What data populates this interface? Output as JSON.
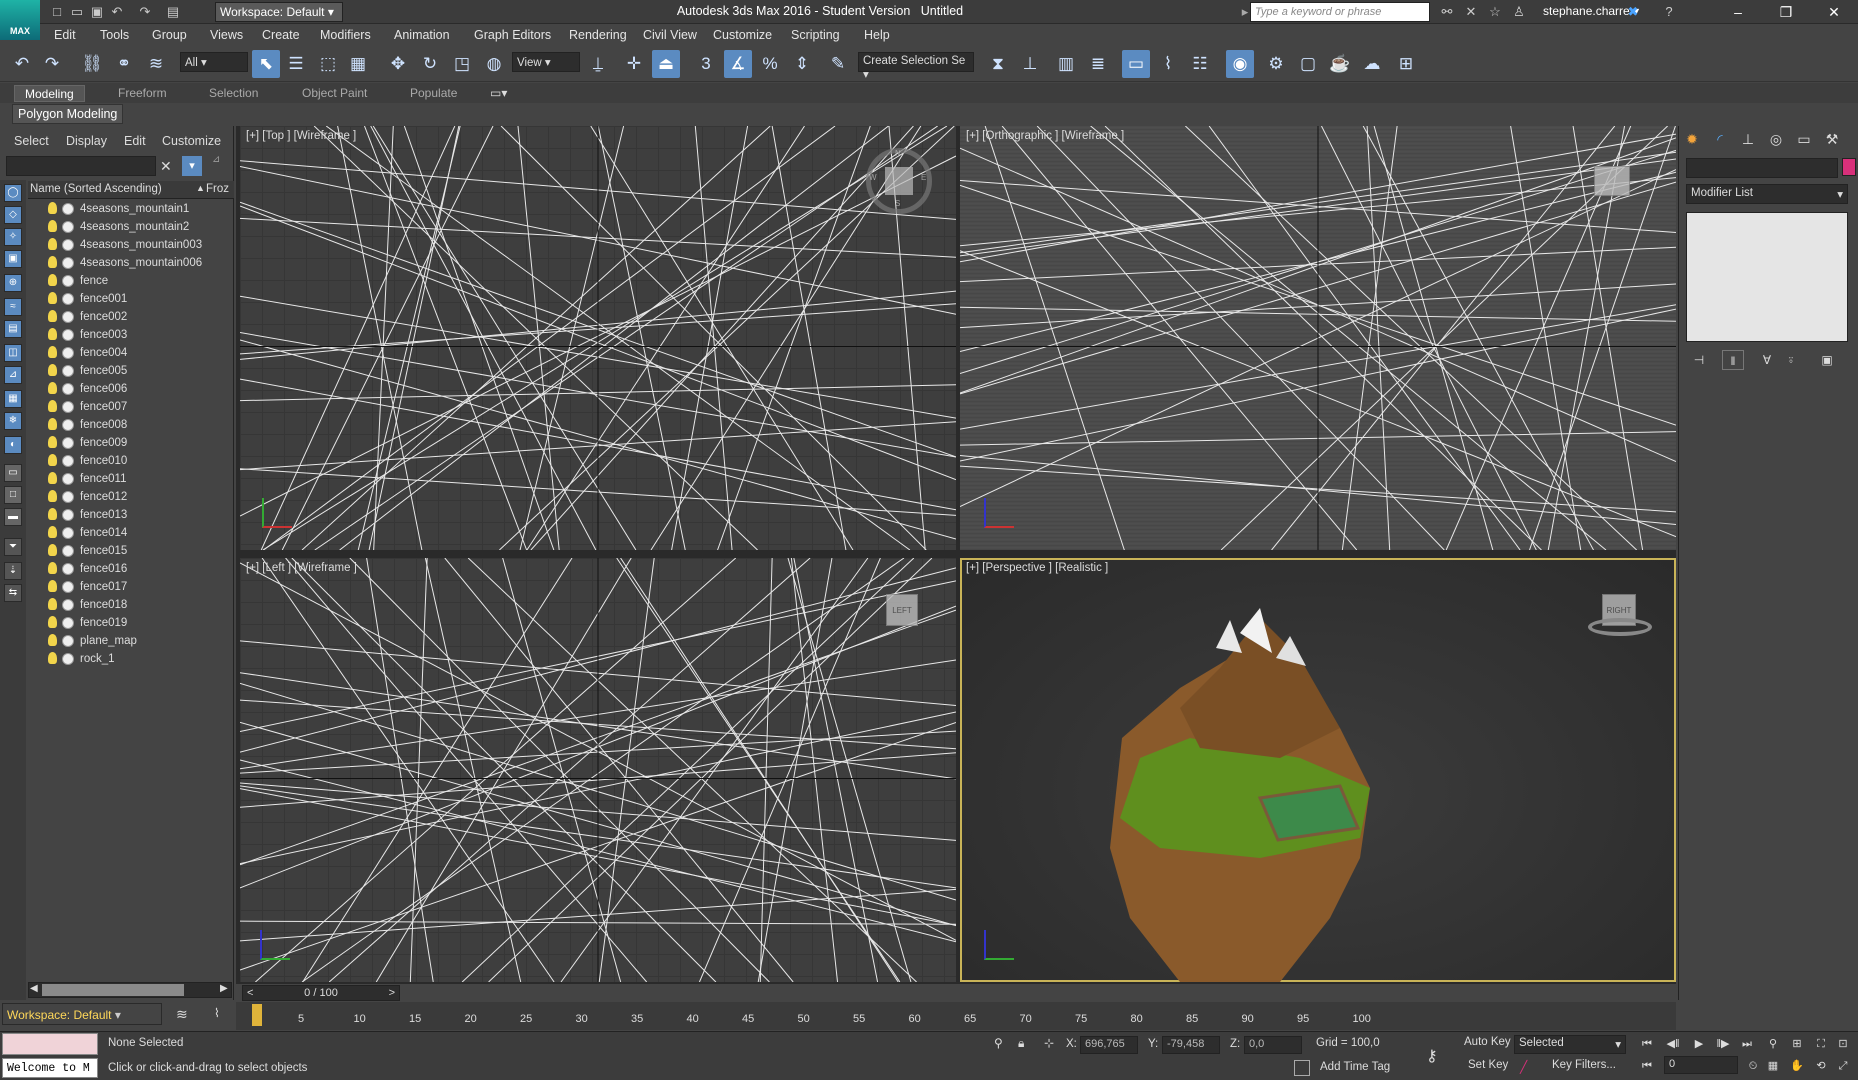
{
  "app": {
    "title": "Autodesk 3ds Max 2016 - Student Version",
    "document": "Untitled",
    "logo_label": "MAX",
    "workspace": "Workspace: Default",
    "search_placeholder": "Type a keyword or phrase",
    "user": "stephane.charre"
  },
  "menubar": [
    "Edit",
    "Tools",
    "Group",
    "Views",
    "Create",
    "Modifiers",
    "Animation",
    "Graph Editors",
    "Rendering",
    "Civil View",
    "Customize",
    "Scripting",
    "Help"
  ],
  "toolbar": {
    "selection_filter": "All",
    "ref_coord": "View",
    "named_selection": "Create Selection Se",
    "snap_label": "3"
  },
  "ribbon": {
    "tabs": [
      "Modeling",
      "Freeform",
      "Selection",
      "Object Paint",
      "Populate"
    ],
    "active_tab": "Modeling",
    "panel": "Polygon Modeling"
  },
  "scene_explorer": {
    "menu": [
      "Select",
      "Display",
      "Edit",
      "Customize"
    ],
    "columns": [
      "Name (Sorted Ascending)",
      "Froz"
    ],
    "items": [
      "4seasons_mountain1",
      "4seasons_mountain2",
      "4seasons_mountain003",
      "4seasons_mountain006",
      "fence",
      "fence001",
      "fence002",
      "fence003",
      "fence004",
      "fence005",
      "fence006",
      "fence007",
      "fence008",
      "fence009",
      "fence010",
      "fence011",
      "fence012",
      "fence013",
      "fence014",
      "fence015",
      "fence016",
      "fence017",
      "fence018",
      "fence019",
      "plane_map",
      "rock_1"
    ]
  },
  "viewports": [
    {
      "label": "[+] [Top ] [Wireframe ]"
    },
    {
      "label": "[+] [Orthographic ] [Wireframe ]"
    },
    {
      "label": "[+] [Left ] [Wireframe ]"
    },
    {
      "label": "[+] [Perspective ] [Realistic ]"
    }
  ],
  "viewcube_labels": {
    "left": "LEFT",
    "right": "RIGHT"
  },
  "compass": {
    "n": "N",
    "s": "S",
    "e": "E",
    "w": "W"
  },
  "timeline": {
    "slider": "0 / 100",
    "ticks": [
      "5",
      "10",
      "15",
      "20",
      "25",
      "30",
      "35",
      "40",
      "45",
      "50",
      "55",
      "60",
      "65",
      "70",
      "75",
      "80",
      "85",
      "90",
      "95",
      "100"
    ]
  },
  "workspace_bottom": "Workspace: Default",
  "status": {
    "selection": "None Selected",
    "prompt": "Click or click-and-drag to select objects",
    "welcome": "Welcome to M",
    "x_label": "X:",
    "x": "696,765",
    "y_label": "Y:",
    "y": "-79,458",
    "z_label": "Z:",
    "z": "0,0",
    "grid": "Grid = 100,0",
    "add_time_tag": "Add Time Tag",
    "auto_key": "Auto Key",
    "set_key": "Set Key",
    "key_mode": "Selected",
    "key_filters": "Key Filters...",
    "frame": "0"
  },
  "command_panel": {
    "modifier_list": "Modifier List"
  },
  "colors": {
    "accent": "#5b8bc1",
    "active_viewport_border": "#c9b458",
    "object_color": "#d8307a",
    "workspace_label": "#ffd85a"
  }
}
